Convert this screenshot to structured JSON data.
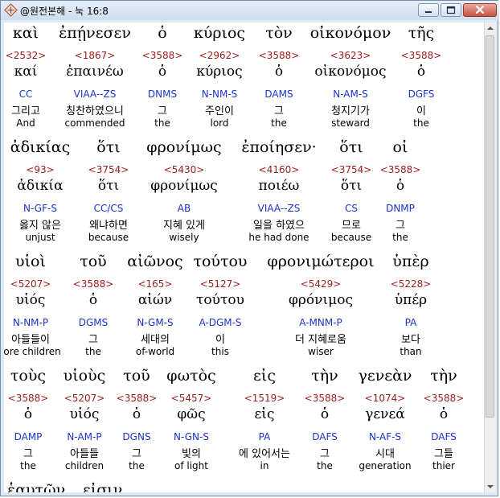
{
  "window": {
    "title": "@원전본해 - 눅 16:8",
    "minimize_label": "minimize",
    "maximize_label": "maximize",
    "close_label": "close"
  },
  "colors": {
    "strong_number": "#9b1c1c",
    "parsing_code": "#1a35c8",
    "text": "#000000"
  },
  "rows": [
    {
      "words": [
        {
          "greek": "καὶ",
          "strong": "<2532>",
          "lemma": "καί",
          "parse": "CC",
          "korean": "그리고",
          "english": "And"
        },
        {
          "greek": "ἐπῄνεσεν",
          "strong": "<1867>",
          "lemma": "ἐπαινέω",
          "parse": "VIAA--ZS",
          "korean": "칭찬하였으니",
          "english": "commended"
        },
        {
          "greek": "ὁ",
          "strong": "<3588>",
          "lemma": "ὁ",
          "parse": "DNMS",
          "korean": "그",
          "english": "the"
        },
        {
          "greek": "κύριος",
          "strong": "<2962>",
          "lemma": "κύριος",
          "parse": "N-NM-S",
          "korean": "주인이",
          "english": "lord"
        },
        {
          "greek": "τὸν",
          "strong": "<3588>",
          "lemma": "ὁ",
          "parse": "DAMS",
          "korean": "그",
          "english": "the"
        },
        {
          "greek": "οἰκονόμον",
          "strong": "<3623>",
          "lemma": "οἰκονόμος",
          "parse": "N-AM-S",
          "korean": "청지기가",
          "english": "steward"
        },
        {
          "greek": "τῆς",
          "strong": "<3588>",
          "lemma": "ὁ",
          "parse": "DGFS",
          "korean": "이",
          "english": "the"
        }
      ]
    },
    {
      "words": [
        {
          "greek": "ἀδικίας",
          "strong": "<93>",
          "lemma": "ἀδικία",
          "parse": "N-GF-S",
          "korean": "옳지 않은",
          "english": "unjust"
        },
        {
          "greek": "ὅτι",
          "strong": "<3754>",
          "lemma": "ὅτι",
          "parse": "CC/CS",
          "korean": "왜냐하면",
          "english": "because"
        },
        {
          "greek": "φρονίμως",
          "strong": "<5430>",
          "lemma": "φρονίμως",
          "parse": "AB",
          "korean": "지혜 있게",
          "english": "wisely"
        },
        {
          "greek": "ἐποίησεν·",
          "strong": "<4160>",
          "lemma": "ποιέω",
          "parse": "VIAA--ZS",
          "korean": "일을 하였으",
          "english": "he had done"
        },
        {
          "greek": "ὅτι",
          "strong": "<3754>",
          "lemma": "ὅτι",
          "parse": "CS",
          "korean": "므로",
          "english": "because"
        },
        {
          "greek": "οἱ",
          "strong": "<3588>",
          "lemma": "ὁ",
          "parse": "DNMP",
          "korean": "그",
          "english": "the"
        }
      ]
    },
    {
      "words": [
        {
          "greek": "υἱοὶ",
          "strong": "<5207>",
          "lemma": "υἱός",
          "parse": "N-NM-P",
          "korean": "아들들이",
          "english": "fore children"
        },
        {
          "greek": "τοῦ",
          "strong": "<3588>",
          "lemma": "ὁ",
          "parse": "DGMS",
          "korean": "그",
          "english": "the"
        },
        {
          "greek": "αἰῶνος",
          "strong": "<165>",
          "lemma": "αἰών",
          "parse": "N-GM-S",
          "korean": "세대의",
          "english": "of-world"
        },
        {
          "greek": "τούτου",
          "strong": "<5127>",
          "lemma": "τούτου",
          "parse": "A-DGM-S",
          "korean": "이",
          "english": "this"
        },
        {
          "greek": "φρονιμώτεροι",
          "strong": "<5429>",
          "lemma": "φρόνιμος",
          "parse": "A-MNM-P",
          "korean": "더 지혜로움",
          "english": "wiser"
        },
        {
          "greek": "ὑπὲρ",
          "strong": "<5228>",
          "lemma": "ὑπέρ",
          "parse": "PA",
          "korean": "보다",
          "english": "than"
        }
      ]
    },
    {
      "words": [
        {
          "greek": "τοὺς",
          "strong": "<3588>",
          "lemma": "ὁ",
          "parse": "DAMP",
          "korean": "그",
          "english": "the"
        },
        {
          "greek": "υἱοὺς",
          "strong": "<5207>",
          "lemma": "υἱός",
          "parse": "N-AM-P",
          "korean": "아들들",
          "english": "children"
        },
        {
          "greek": "τοῦ",
          "strong": "<3588>",
          "lemma": "ὁ",
          "parse": "DGNS",
          "korean": "그",
          "english": "the"
        },
        {
          "greek": "φωτὸς",
          "strong": "<5457>",
          "lemma": "φῶς",
          "parse": "N-GN-S",
          "korean": "빛의",
          "english": "of light"
        },
        {
          "greek": "εἰς",
          "strong": "<1519>",
          "lemma": "εἰς",
          "parse": "PA",
          "korean": "에 있어서는",
          "english": "in"
        },
        {
          "greek": "τὴν",
          "strong": "<3588>",
          "lemma": "ὁ",
          "parse": "DAFS",
          "korean": "그",
          "english": "the"
        },
        {
          "greek": "γενεὰν",
          "strong": "<1074>",
          "lemma": "γενεά",
          "parse": "N-AF-S",
          "korean": "시대",
          "english": "generation"
        },
        {
          "greek": "τὴν",
          "strong": "<3588>",
          "lemma": "ὁ",
          "parse": "DAFS",
          "korean": "그들",
          "english": "thier"
        }
      ]
    }
  ],
  "partial_row": [
    "ἑαυτῶν",
    "εἰσιν"
  ]
}
